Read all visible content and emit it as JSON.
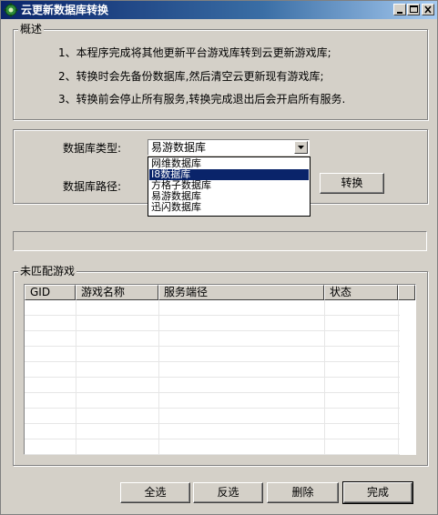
{
  "window": {
    "title": "云更新数据库转换",
    "controls": [
      "minimize-icon",
      "maximize-icon",
      "close-icon"
    ]
  },
  "overview": {
    "legend": "概述",
    "lines": [
      "1、本程序完成将其他更新平台游戏库转到云更新游戏库;",
      "2、转换时会先备份数据库,然后清空云更新现有游戏库;",
      "3、转换前会停止所有服务,转换完成退出后会开启所有服务."
    ]
  },
  "settings": {
    "db_type_label": "数据库类型:",
    "db_type_value": "易游数据库",
    "db_path_label": "数据库路径:",
    "convert_button": "转换",
    "dropdown_options": [
      "网维数据库",
      "I8数据库",
      "方格子数据库",
      "易游数据库",
      "迅闪数据库"
    ],
    "dropdown_selected_index": 1
  },
  "unmatched": {
    "legend": "未匹配游戏",
    "columns": [
      "GID",
      "游戏名称",
      "服务端径",
      "状态"
    ],
    "rows": []
  },
  "footer": {
    "select_all": "全选",
    "invert": "反选",
    "delete": "删除",
    "done": "完成"
  }
}
